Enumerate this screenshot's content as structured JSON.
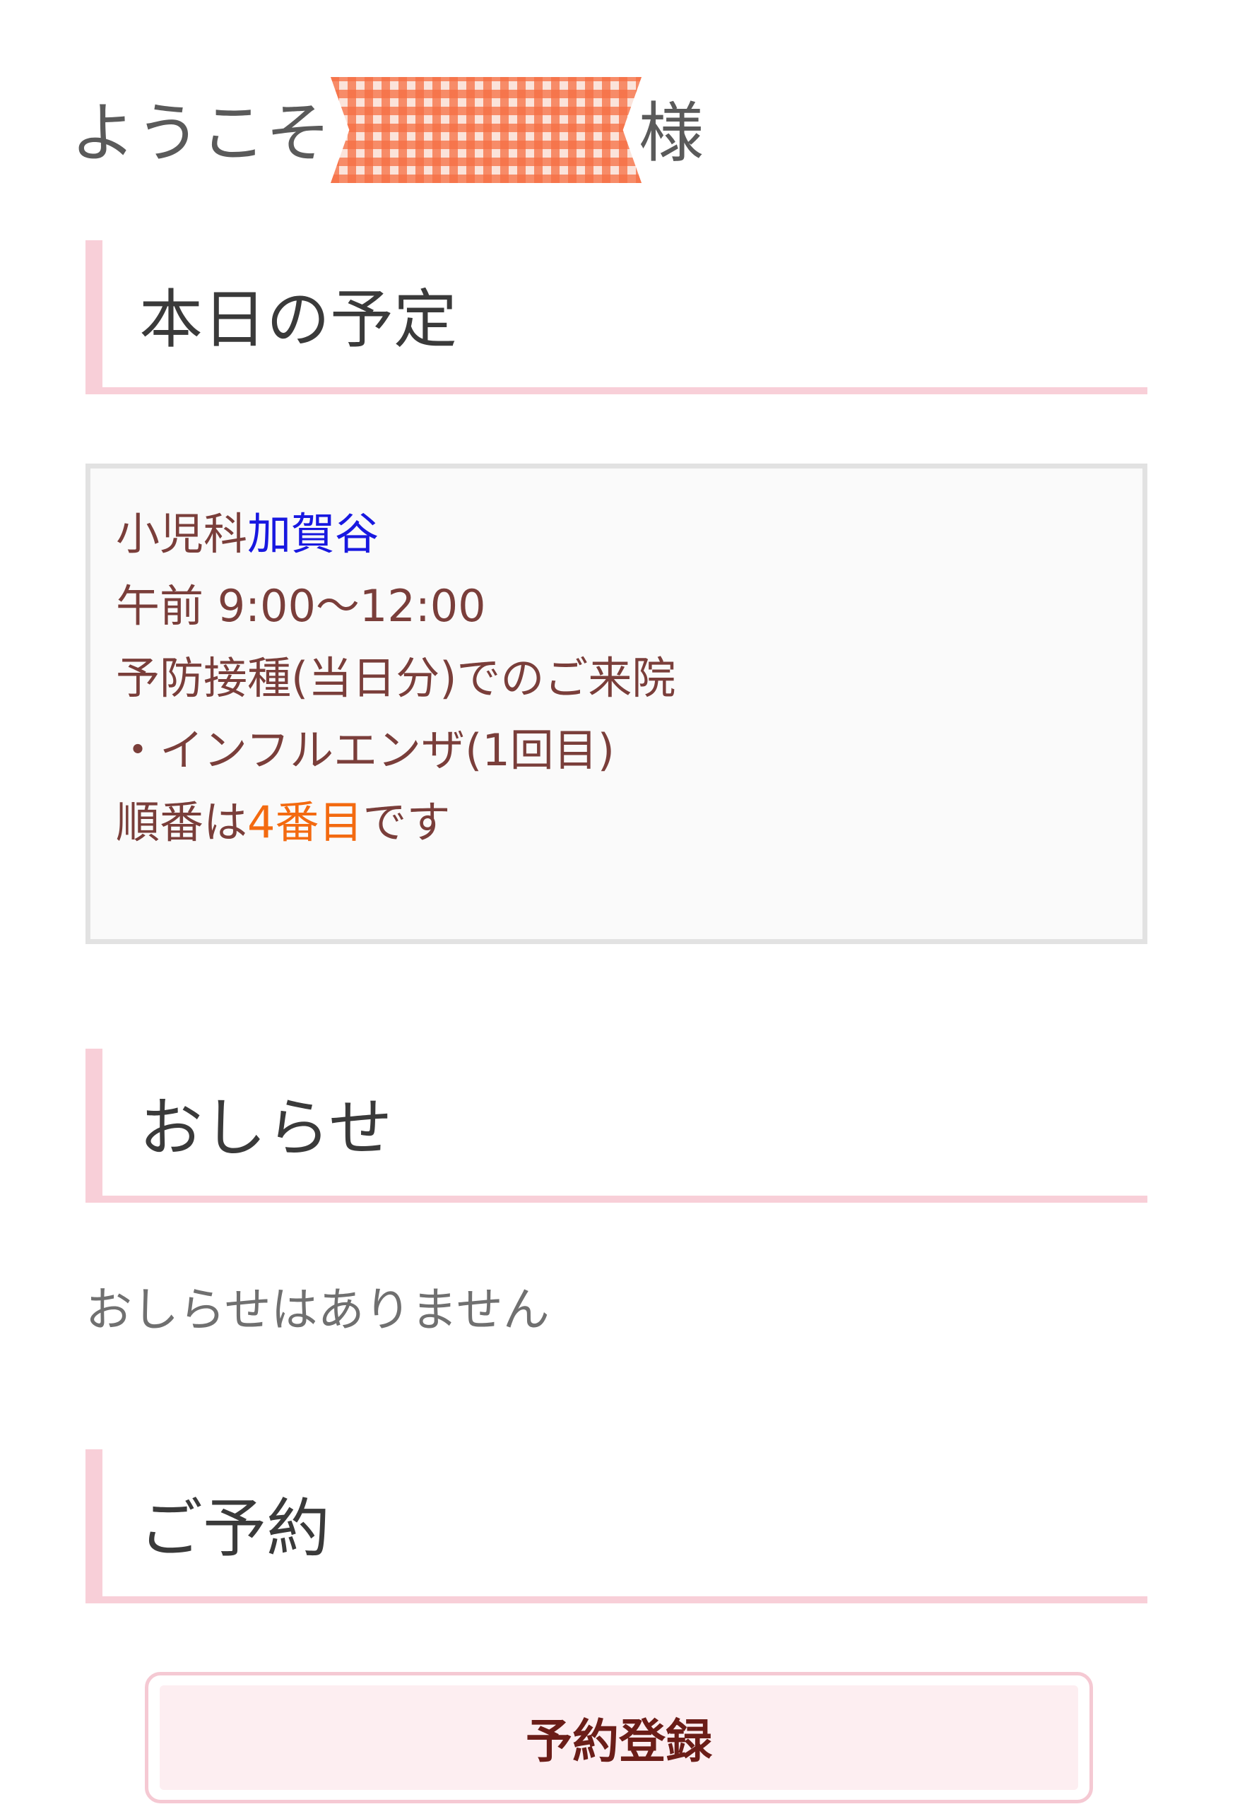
{
  "welcome": {
    "prefix": "ようこそ",
    "suffix": "様"
  },
  "sections": {
    "schedule": {
      "heading": "本日の予定",
      "department": "小児科",
      "doctor": "加賀谷",
      "time": "午前 9:00〜12:00",
      "visit_type": "予防接種(当日分)でのご来院",
      "vaccine": "・インフルエンザ(1回目)",
      "order_prefix": "順番は",
      "order_number": "4番目",
      "order_suffix": "です"
    },
    "notices": {
      "heading": "おしらせ",
      "empty_message": "おしらせはありません"
    },
    "reservation": {
      "heading": "ご予約",
      "register_label": "予約登録"
    }
  },
  "colors": {
    "accent_pink": "#f8cfd8",
    "schedule_text": "#7a3e3a",
    "doctor_name": "#1818e0",
    "order_highlight": "#f36a10",
    "button_text": "#6b1d18"
  }
}
